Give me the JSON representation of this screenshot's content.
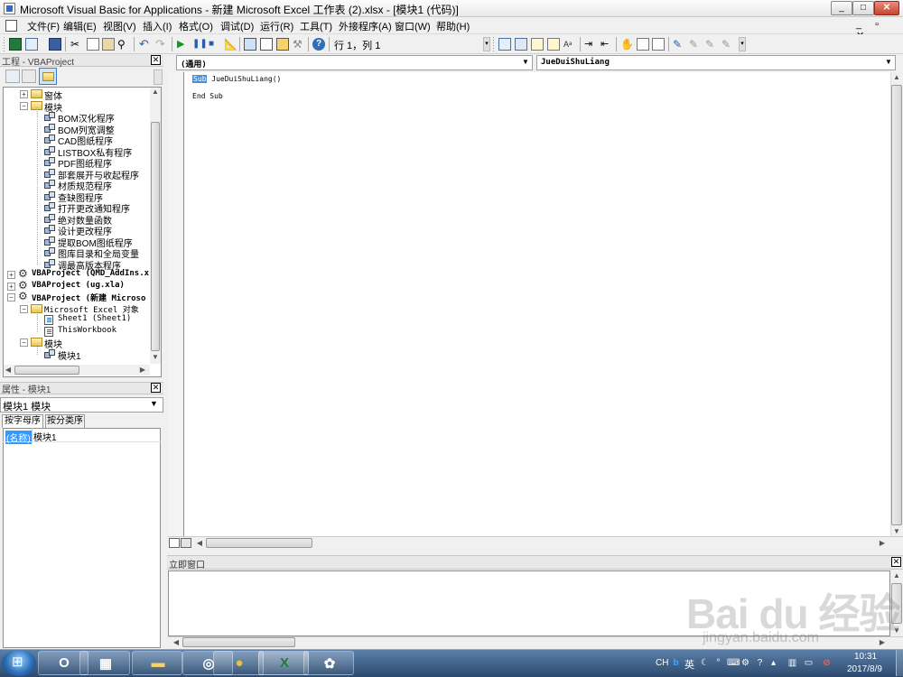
{
  "window": {
    "title": "Microsoft Visual Basic for Applications - 新建 Microsoft Excel 工作表 (2).xlsx - [模块1 (代码)]",
    "controls": {
      "minimize": "_",
      "maximize": "□",
      "close": "✕"
    }
  },
  "menu": {
    "items": [
      "文件(F)",
      "编辑(E)",
      "视图(V)",
      "插入(I)",
      "格式(O)",
      "调试(D)",
      "运行(R)",
      "工具(T)",
      "外接程序(A)",
      "窗口(W)",
      "帮助(H)"
    ],
    "mdi_controls": "_ ▫ ✕"
  },
  "toolbar": {
    "cursor_position": "行 1，列 1",
    "icons": [
      "excel-icon",
      "insert-userform-icon",
      "save-icon",
      "cut-icon",
      "copy-icon",
      "paste-icon",
      "find-icon",
      "undo-icon",
      "redo-icon",
      "run-icon",
      "break-icon",
      "reset-icon",
      "design-mode-icon",
      "project-explorer-icon",
      "properties-icon",
      "object-browser-icon",
      "toolbox-icon",
      "help-icon",
      "list-properties-icon",
      "list-constants-icon",
      "quick-info-icon",
      "parameter-info-icon",
      "complete-word-icon",
      "indent-icon",
      "outdent-icon",
      "toggle-breakpoint-icon",
      "comment-block-icon",
      "uncomment-block-icon",
      "toggle-bookmark-icon",
      "next-bookmark-icon",
      "previous-bookmark-icon",
      "clear-bookmarks-icon"
    ]
  },
  "project": {
    "title": "工程 - VBAProject",
    "close": "✕",
    "tree": [
      {
        "label": "窗体",
        "kind": "folder",
        "level": 1,
        "toggle": "+"
      },
      {
        "label": "模块",
        "kind": "folder",
        "level": 1,
        "toggle": "−"
      },
      {
        "label": "BOM汉化程序",
        "kind": "module",
        "level": 2
      },
      {
        "label": "BOM列宽调整",
        "kind": "module",
        "level": 2
      },
      {
        "label": "CAD图纸程序",
        "kind": "module",
        "level": 2
      },
      {
        "label": "LISTBOX私有程序",
        "kind": "module",
        "level": 2
      },
      {
        "label": "PDF图纸程序",
        "kind": "module",
        "level": 2
      },
      {
        "label": "部套展开与收起程序",
        "kind": "module",
        "level": 2
      },
      {
        "label": "材质规范程序",
        "kind": "module",
        "level": 2
      },
      {
        "label": "查缺图程序",
        "kind": "module",
        "level": 2
      },
      {
        "label": "打开更改通知程序",
        "kind": "module",
        "level": 2
      },
      {
        "label": "绝对数量函数",
        "kind": "module",
        "level": 2
      },
      {
        "label": "设计更改程序",
        "kind": "module",
        "level": 2
      },
      {
        "label": "提取BOM图纸程序",
        "kind": "module",
        "level": 2
      },
      {
        "label": "图库目录和全局变量",
        "kind": "module",
        "level": 2
      },
      {
        "label": "调最高版本程序",
        "kind": "module",
        "level": 2
      },
      {
        "label": "VBAProject (QMD_AddIns.x",
        "kind": "project",
        "level": 0,
        "toggle": "+"
      },
      {
        "label": "VBAProject (ug.xla)",
        "kind": "project",
        "level": 0,
        "toggle": "+"
      },
      {
        "label": "VBAProject (新建 Microso",
        "kind": "project",
        "level": 0,
        "toggle": "−"
      },
      {
        "label": "Microsoft Excel 对象",
        "kind": "folder",
        "level": 1,
        "toggle": "−"
      },
      {
        "label": "Sheet1 (Sheet1)",
        "kind": "sheet",
        "level": 2
      },
      {
        "label": "ThisWorkbook",
        "kind": "sheet",
        "level": 2
      },
      {
        "label": "模块",
        "kind": "folder",
        "level": 1,
        "toggle": "−"
      },
      {
        "label": "模块1",
        "kind": "module",
        "level": 2
      }
    ]
  },
  "properties": {
    "title": "属性 - 模块1",
    "close": "✕",
    "object": "模块1 模块",
    "tabs": [
      "按字母序",
      "按分类序"
    ],
    "rows": [
      {
        "name": "(名称)",
        "value": "模块1"
      }
    ]
  },
  "code": {
    "object_combo": "(通用)",
    "procedure_combo": "JueDuiShuLiang",
    "keyword_sub": "Sub",
    "line1_rest": " JueDuiShuLiang()",
    "line2": "End Sub"
  },
  "immediate": {
    "title": "立即窗口",
    "close": "✕"
  },
  "taskbar": {
    "apps": [
      "outlook-icon",
      "calculator-icon",
      "file-explorer-icon",
      "app-swirl-icon",
      "chrome-icon",
      "excel-icon",
      "paint-icon"
    ],
    "tray": {
      "lang": "CH",
      "ime": "英",
      "time": "10:31",
      "date": "2017/8/9"
    }
  },
  "watermark": {
    "logo": "Bai du 经验",
    "url": "jingyan.baidu.com"
  },
  "colors": {
    "selection": "#3399ff",
    "taskbar": "#2c4a6e",
    "keyword": "#4a90d9"
  }
}
